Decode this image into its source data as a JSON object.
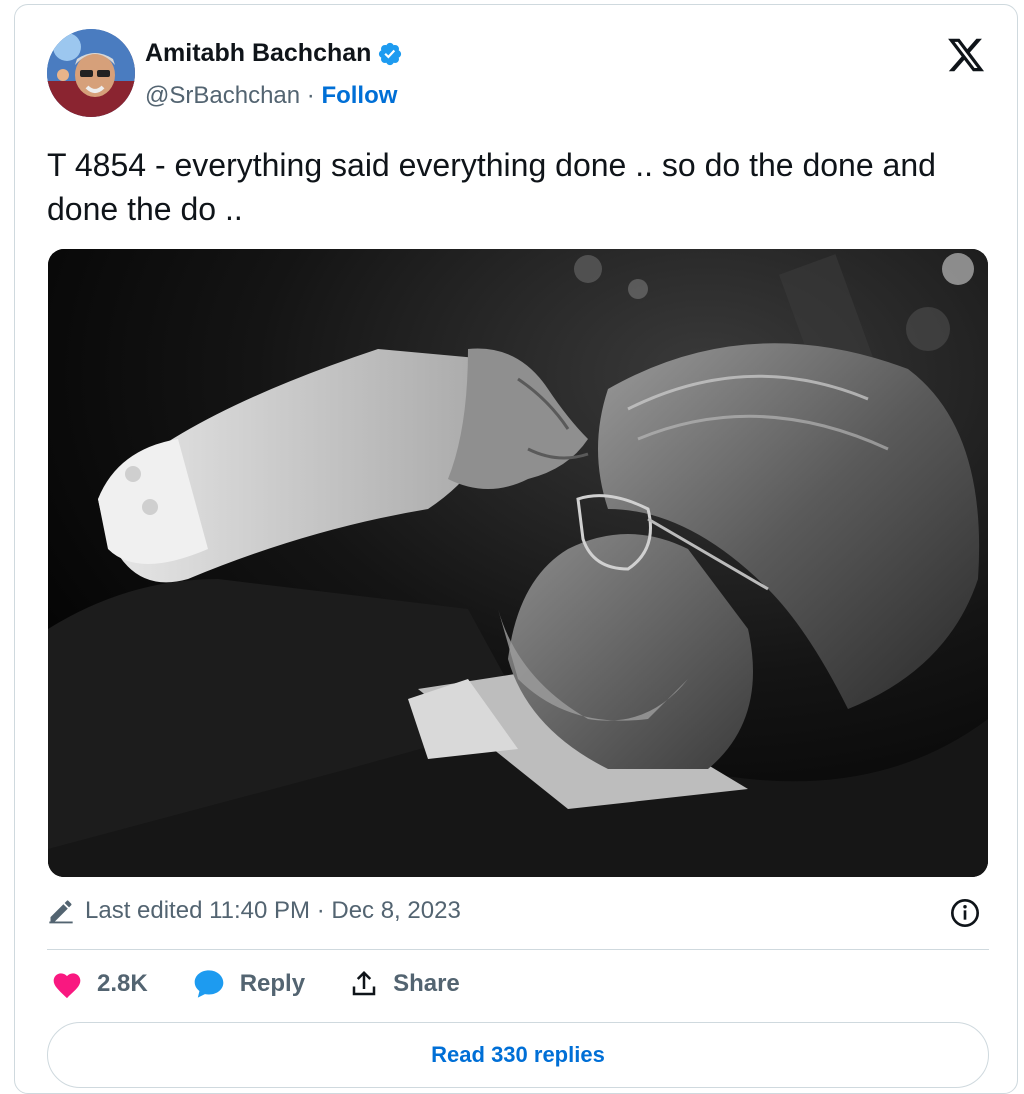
{
  "author": {
    "name": "Amitabh Bachchan",
    "handle": "@SrBachchan",
    "separator": " · ",
    "follow_label": "Follow",
    "verified_color": "#1d9bf0"
  },
  "tweet": {
    "text": "T 4854 - everything said everything done .. so do the done and done the do .."
  },
  "meta": {
    "edited_label": "Last edited 11:40 PM · Dec 8, 2023"
  },
  "actions": {
    "like_count": "2.8K",
    "reply_label": "Reply",
    "share_label": "Share",
    "like_color": "#f91880",
    "reply_color": "#1d9bf0"
  },
  "replies": {
    "read_label": "Read 330 replies"
  },
  "icons": {
    "logo": "x-logo-icon",
    "verified": "verified-badge-icon",
    "edit": "pencil-icon",
    "info": "info-icon",
    "like": "heart-icon",
    "reply": "speech-bubble-icon",
    "share": "share-upload-icon"
  }
}
